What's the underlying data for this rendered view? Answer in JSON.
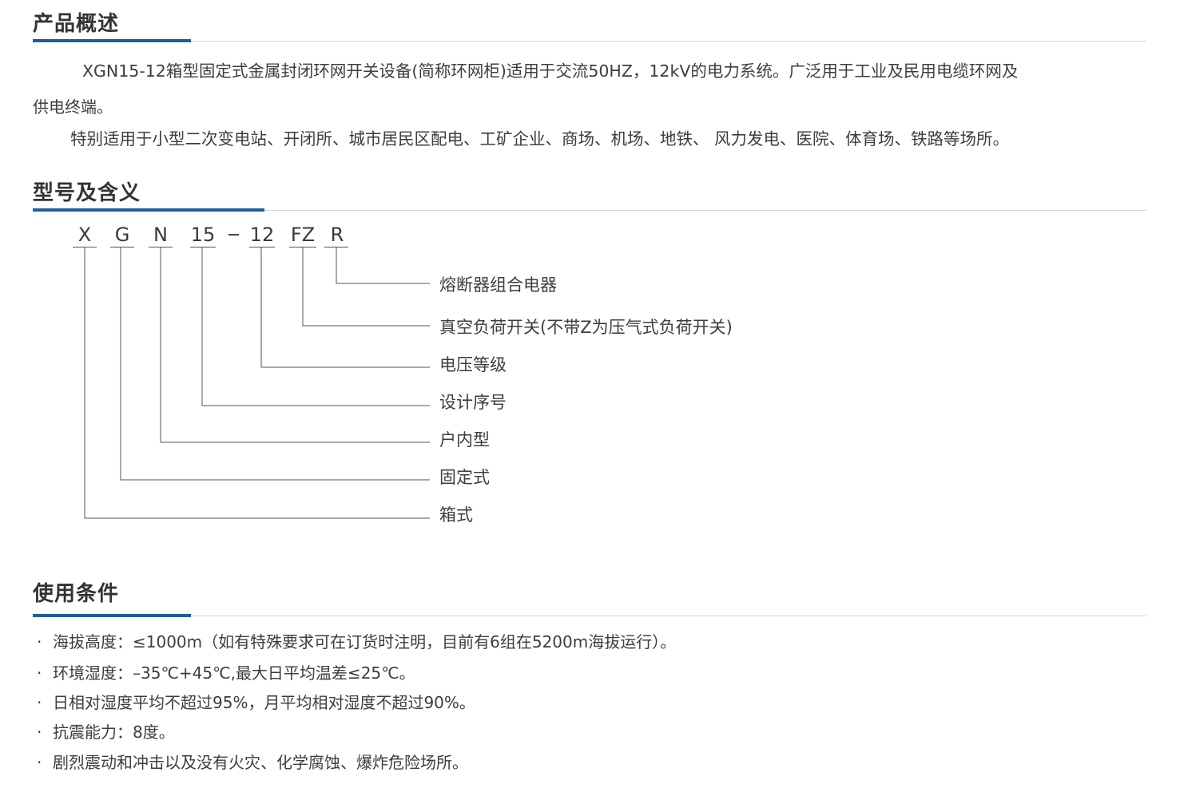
{
  "sections": {
    "overview": {
      "title": "产品概述",
      "para1_line1": "XGN15-12箱型固定式金属封闭环网开关设备(简称环网柜)适用于交流50HZ，12kV的电力系统。广泛用于工业及民用电缆环网及",
      "para1_line2": "供电终端。",
      "para2": "特别适用于小型二次变电站、开闭所、城市居民区配电、工矿企业、商场、机场、地铁、 风力发电、医院、体育场、铁路等场所。"
    },
    "model": {
      "title": "型号及含义",
      "code": [
        "X",
        "G",
        "N",
        "15",
        "12",
        "FZ",
        "R"
      ],
      "meanings": [
        "熔断器组合电器",
        "真空负荷开关(不带Z为压气式负荷开关)",
        "电压等级",
        "设计序号",
        "户内型",
        "固定式",
        "箱式"
      ]
    },
    "conditions": {
      "title": "使用条件",
      "bullet": "·",
      "items": [
        "海拔高度：≤1000m（如有特殊要求可在订货时注明，目前有6组在5200m海拔运行）。",
        "环境湿度：–35℃+45℃,最大日平均温差≤25℃。",
        "日相对湿度平均不超过95%，月平均相对湿度不超过90%。",
        "抗震能力：8度。",
        "剧烈震动和冲击以及没有火灾、化学腐蚀、爆炸危险场所。"
      ]
    }
  },
  "colors": {
    "accent": "#1f5e9b",
    "rule": "#d3d3d3",
    "text": "#3d3d3d"
  }
}
